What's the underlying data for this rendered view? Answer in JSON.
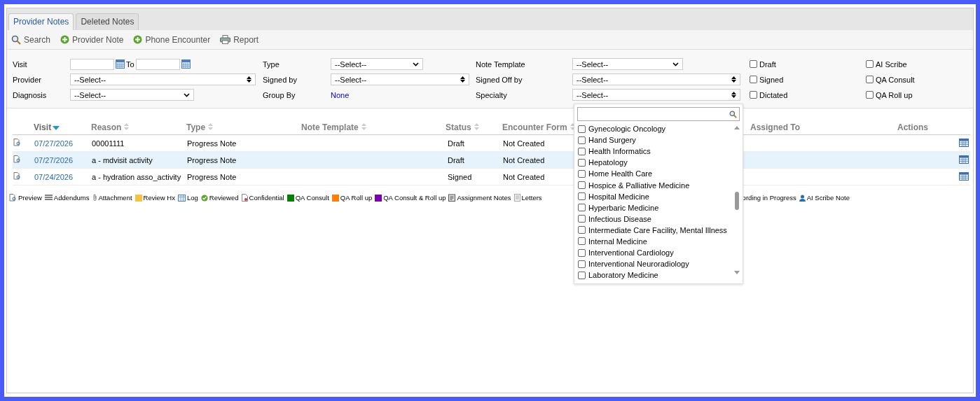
{
  "tabs": [
    {
      "label": "Provider Notes",
      "selected": true
    },
    {
      "label": "Deleted Notes",
      "selected": false
    }
  ],
  "toolbar": [
    {
      "label": "Search",
      "kind": "search"
    },
    {
      "label": "Provider Note",
      "kind": "add"
    },
    {
      "label": "Phone Encounter",
      "kind": "add"
    },
    {
      "label": "Report",
      "kind": "print"
    }
  ],
  "filters": {
    "visit": {
      "label": "Visit",
      "to_label": "To"
    },
    "provider": {
      "label": "Provider",
      "value": "--Select--"
    },
    "diagnosis": {
      "label": "Diagnosis",
      "value": "--Select--"
    },
    "type": {
      "label": "Type",
      "value": "--Select--"
    },
    "signed_by": {
      "label": "Signed by",
      "value": "--Select--"
    },
    "group_by": {
      "label": "Group By",
      "value": "None"
    },
    "note_template": {
      "label": "Note Template",
      "value": "--Select--"
    },
    "signed_off_by": {
      "label": "Signed Off by",
      "value": "--Select--"
    },
    "specialty": {
      "label": "Specialty",
      "value": "--Select--",
      "expanded": true
    },
    "checkboxes": [
      {
        "label": "Draft",
        "checked": false
      },
      {
        "label": "AI Scribe",
        "checked": false
      },
      {
        "label": "Signed",
        "checked": false
      },
      {
        "label": "QA Consult",
        "checked": false
      },
      {
        "label": "Dictated",
        "checked": false
      },
      {
        "label": "QA Roll up",
        "checked": false
      }
    ]
  },
  "specialty_options": [
    {
      "label": "Gynecologic Oncology",
      "checked": false
    },
    {
      "label": "Hand Surgery",
      "checked": false
    },
    {
      "label": "Health Informatics",
      "checked": false
    },
    {
      "label": "Hepatology",
      "checked": false
    },
    {
      "label": "Home Health Care",
      "checked": false
    },
    {
      "label": "Hospice & Palliative Medicine",
      "checked": false
    },
    {
      "label": "Hospital Medicine",
      "checked": false
    },
    {
      "label": "Hyperbaric Medicine",
      "checked": false
    },
    {
      "label": "Infectious Disease",
      "checked": false
    },
    {
      "label": "Intermediate Care Facility, Mental Illness",
      "checked": false
    },
    {
      "label": "Internal Medicine",
      "checked": false
    },
    {
      "label": "Interventional Cardiology",
      "checked": false
    },
    {
      "label": "Interventional Neuroradiology",
      "checked": false
    },
    {
      "label": "Laboratory Medicine",
      "checked": false
    }
  ],
  "table": {
    "columns": [
      {
        "label": "Visit",
        "sortable": true,
        "sorted": true
      },
      {
        "label": "Reason",
        "sortable": true,
        "sorted": false
      },
      {
        "label": "Type",
        "sortable": true,
        "sorted": false
      },
      {
        "label": "Note Template",
        "sortable": true,
        "sorted": false
      },
      {
        "label": "Status",
        "sortable": true,
        "sorted": false
      },
      {
        "label": "Encounter Form",
        "sortable": true,
        "sorted": false
      },
      {
        "label": "Assigned To",
        "sortable": false,
        "sorted": false
      },
      {
        "label": "Actions",
        "sortable": false,
        "sorted": false
      }
    ],
    "rows": [
      {
        "visit": "07/27/2026",
        "reason": "00001111",
        "type": "Progress Note",
        "status": "Draft",
        "encounter_form": "Not Created",
        "selected": false
      },
      {
        "visit": "07/27/2026",
        "reason": "a - mdvisit activity",
        "type": "Progress Note",
        "status": "Draft",
        "encounter_form": "Not Created",
        "selected": true
      },
      {
        "visit": "07/24/2026",
        "reason": "a - hydration asso_activity",
        "type": "Progress Note",
        "status": "Signed",
        "encounter_form": "Not Created",
        "selected": false
      }
    ]
  },
  "legend": [
    {
      "label": "Preview",
      "kind": "preview"
    },
    {
      "label": "Addendums",
      "kind": "lines"
    },
    {
      "label": "Attachment",
      "kind": "clip"
    },
    {
      "label": "Review Hx",
      "kind": "note"
    },
    {
      "label": "Log",
      "kind": "grid"
    },
    {
      "label": "Reviewed",
      "kind": "check"
    },
    {
      "label": "Confidential",
      "kind": "doc"
    },
    {
      "label": "QA Consult",
      "kind": "square",
      "color": "#008000"
    },
    {
      "label": "QA Roll up",
      "kind": "square",
      "color": "#ff7f00"
    },
    {
      "label": "QA Consult & Roll up",
      "kind": "square",
      "color": "#7a00b0"
    },
    {
      "label": "Assignment Notes",
      "kind": "clipboard"
    },
    {
      "label": "Letters",
      "kind": "page"
    }
  ],
  "legend_right": [
    {
      "label": "ording in Progress",
      "kind": "none"
    },
    {
      "label": "AI Scribe Note",
      "kind": "person"
    }
  ]
}
